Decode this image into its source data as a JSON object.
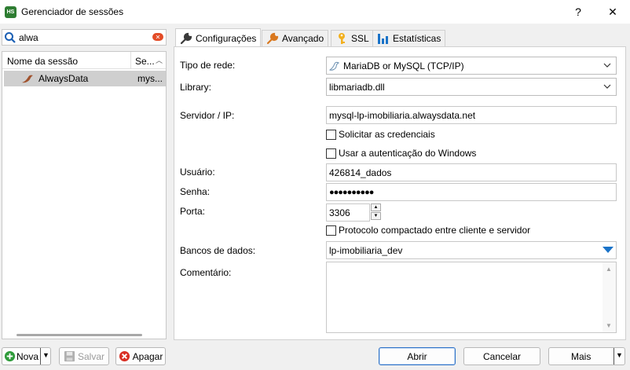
{
  "window": {
    "title": "Gerenciador de sessões",
    "app_icon": "HS",
    "help_label": "?",
    "close_label": "✕"
  },
  "search": {
    "value": "alwa"
  },
  "session_list": {
    "columns": [
      "Nome da sessão",
      "Se..."
    ],
    "rows": [
      {
        "name": "AlwaysData",
        "type": "mys..."
      }
    ]
  },
  "tabs": [
    {
      "label": "Configurações",
      "icon": "wrench-icon",
      "active": true
    },
    {
      "label": "Avançado",
      "icon": "wrench-orange-icon",
      "active": false
    },
    {
      "label": "SSL",
      "icon": "key-icon",
      "active": false
    },
    {
      "label": "Estatísticas",
      "icon": "bar-chart-icon",
      "active": false
    }
  ],
  "form": {
    "network_type_label": "Tipo de rede:",
    "network_type_value": "MariaDB or MySQL (TCP/IP)",
    "library_label": "Library:",
    "library_value": "libmariadb.dll",
    "server_label": "Servidor / IP:",
    "server_value": "mysql-lp-imobiliaria.alwaysdata.net",
    "ask_credentials_label": "Solicitar as credenciais",
    "windows_auth_label": "Usar a autenticação do Windows",
    "user_label": "Usuário:",
    "user_value": "426814_dados",
    "password_label": "Senha:",
    "password_value": "●●●●●●●●●●",
    "port_label": "Porta:",
    "port_value": "3306",
    "compression_label": "Protocolo compactado entre cliente e servidor",
    "databases_label": "Bancos de dados:",
    "databases_value": "lp-imobiliaria_dev",
    "comment_label": "Comentário:",
    "comment_value": ""
  },
  "buttons": {
    "new": "Nova",
    "save": "Salvar",
    "delete": "Apagar",
    "open": "Abrir",
    "cancel": "Cancelar",
    "more": "Mais"
  },
  "colors": {
    "accent_blue": "#2e72c8",
    "selection_gray": "#cfcfcf",
    "clear_icon_red": "#e34b26"
  }
}
